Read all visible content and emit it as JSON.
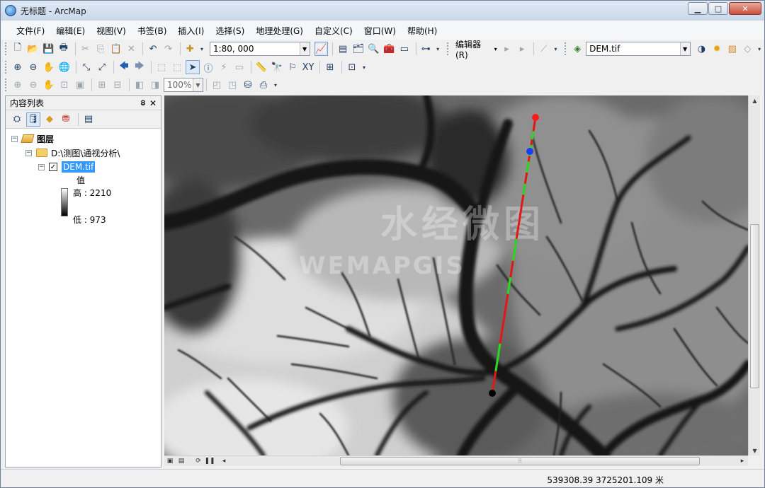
{
  "window": {
    "title": "无标题 - ArcMap"
  },
  "menu": [
    "文件(F)",
    "编辑(E)",
    "视图(V)",
    "书签(B)",
    "插入(I)",
    "选择(S)",
    "地理处理(G)",
    "自定义(C)",
    "窗口(W)",
    "帮助(H)"
  ],
  "toolbar": {
    "scale_value": "1:80, 000",
    "editor_label": "编辑器(R)",
    "layer_combo": "DEM.tif",
    "zoom_percent": "100%"
  },
  "toc": {
    "title": "内容列表",
    "root_label": "图层",
    "folder_label": "D:\\测图\\通视分析\\",
    "layer_name": "DEM.tif",
    "legend_heading": "值",
    "legend_high": "高 : 2210",
    "legend_low": "低 : 973"
  },
  "map": {
    "watermark_cn": "水经微图",
    "watermark_en": "WEMAPGIS"
  },
  "status": {
    "coordinates": "539308.39  3725201.109 米"
  },
  "colors": {
    "sightline_visible": "#22dd22",
    "sightline_hidden": "#e01818",
    "observer_point": "#000000",
    "target_point": "#ff1a1a",
    "obstruction_point": "#1a3cff"
  }
}
